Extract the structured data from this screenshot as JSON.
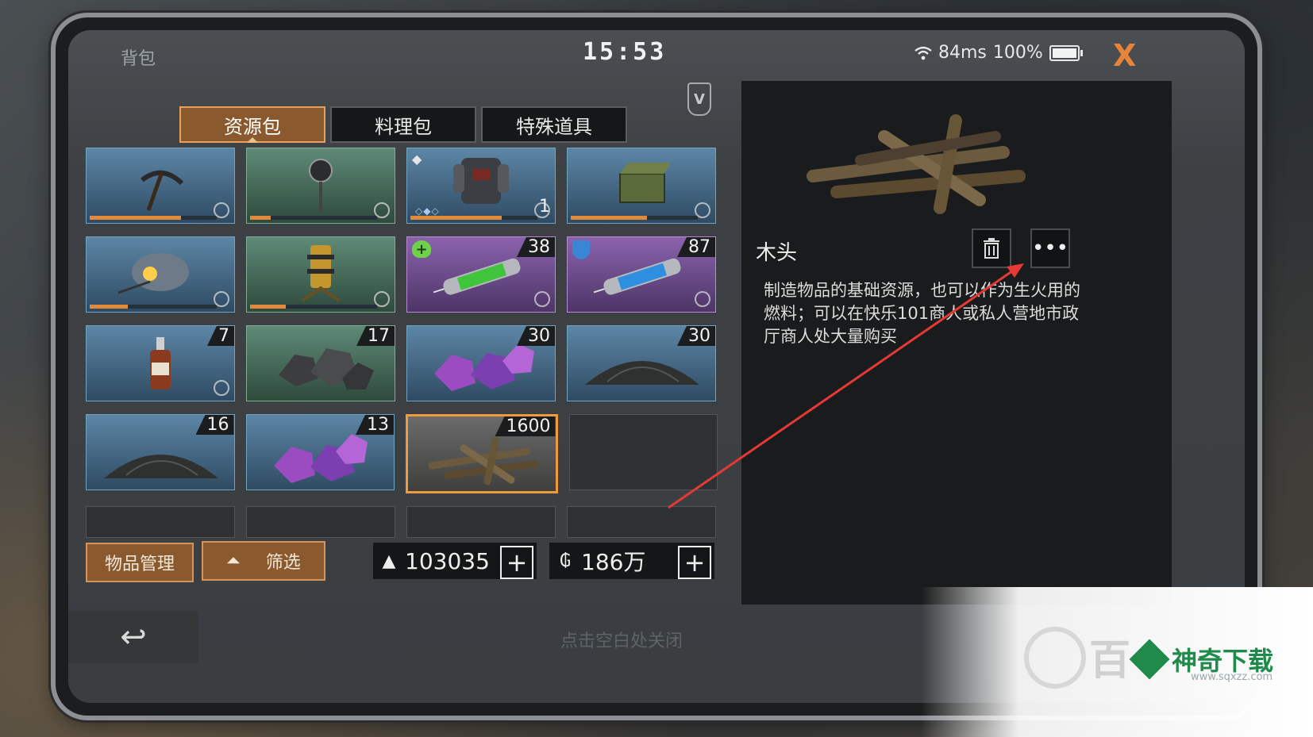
{
  "topbar": {
    "title": "背包",
    "clock": "15:53",
    "ping": "84ms",
    "battery": "100%",
    "close": "X"
  },
  "badge_label": "V",
  "tabs": [
    {
      "label": "资源包",
      "active": true
    },
    {
      "label": "料理包",
      "active": false
    },
    {
      "label": "特殊道具",
      "active": false
    }
  ],
  "grid": {
    "row1": [
      {
        "icon": "pickaxe-icon",
        "style": "blue",
        "durability": 0.72
      },
      {
        "icon": "stop-sign-icon",
        "style": "green",
        "durability": 0.16
      },
      {
        "icon": "armor-vest-icon",
        "style": "blue",
        "count": "1",
        "durability": 0.72
      },
      {
        "icon": "storage-box-icon",
        "style": "blue",
        "durability": 0.6
      }
    ],
    "row2": [
      {
        "icon": "drone-icon",
        "style": "blue",
        "durability": 0.3
      },
      {
        "icon": "turret-icon",
        "style": "green",
        "durability": 0.28
      },
      {
        "icon": "syringe-green-icon",
        "style": "purple",
        "count": "38"
      },
      {
        "icon": "syringe-blue-icon",
        "style": "purple",
        "count": "87"
      }
    ],
    "row3": [
      {
        "icon": "bottle-icon",
        "style": "blue",
        "count": "7"
      },
      {
        "icon": "coal-ore-icon",
        "style": "green",
        "count": "17"
      },
      {
        "icon": "crystal-ore-icon",
        "style": "blue",
        "count": "30"
      },
      {
        "icon": "gravel-pile-icon",
        "style": "blue",
        "count": "30"
      }
    ],
    "row4": [
      {
        "icon": "gravel-pile-icon",
        "style": "blue",
        "count": "16"
      },
      {
        "icon": "crystal-ore-icon",
        "style": "blue",
        "count": "13"
      },
      {
        "icon": "wood-logs-icon",
        "style": "selected",
        "count": "1600"
      }
    ]
  },
  "buttons": {
    "manage": "物品管理",
    "filter": "筛选"
  },
  "currency": {
    "gold": "103035",
    "coin": "186万"
  },
  "detail": {
    "name": "木头",
    "description": "制造物品的基础资源，也可以作为生火用的燃料；可以在快乐101商人或私人营地市政厅商人处大量购买"
  },
  "footer": {
    "close_hint": "点击空白处关闭"
  },
  "watermark": {
    "bai": "百",
    "brand": "神奇下载",
    "url": "www.sqxzz.com"
  },
  "colors": {
    "accent": "#e8833a",
    "selected": "#f09a3e",
    "arrow": "#e53935"
  }
}
